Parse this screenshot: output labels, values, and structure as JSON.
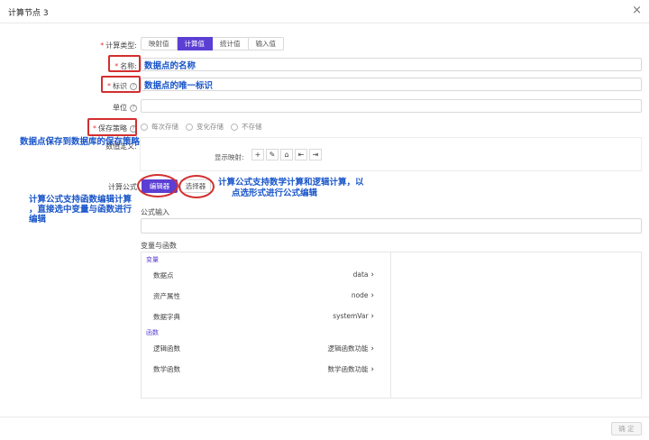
{
  "dialog": {
    "title": "计算节点 3",
    "close_icon": "×",
    "ok_label": "确 定"
  },
  "form": {
    "calc_type": {
      "label": "计算类型:",
      "options": [
        "映射值",
        "计算值",
        "统计值",
        "输入值"
      ],
      "selected": "计算值"
    },
    "name_label": "名称:",
    "id_label": "标识",
    "unit_label": "单位",
    "save_strategy": {
      "label": "保存策略",
      "options": [
        "每次存储",
        "变化存储",
        "不存储"
      ]
    },
    "value_def_label": "数值定义:",
    "display_map_label": "显示映射:",
    "display_tools": [
      "+",
      "✎",
      "⌂",
      "⇤",
      "⇥"
    ],
    "formula_label": "计算公式",
    "formula_buttons": {
      "editor": "编辑器",
      "selector": "选择器"
    },
    "formula_input_label": "公式输入",
    "vars_funcs_label": "变量与函数"
  },
  "vars_funcs": {
    "variables_group": "变量",
    "variables": [
      {
        "name": "数据点",
        "value": "data"
      },
      {
        "name": "资产属性",
        "value": "node"
      },
      {
        "name": "数据字典",
        "value": "systemVar"
      }
    ],
    "functions_group": "函数",
    "functions": [
      {
        "name": "逻辑函数",
        "value": "逻辑函数功能"
      },
      {
        "name": "数学函数",
        "value": "数学函数功能"
      }
    ]
  },
  "annotations": {
    "name_note": "数据点的名称",
    "id_note": "数据点的唯一标识",
    "save_note": "数据点保存到数据库的保存策略",
    "selector_note_line1": "计算公式支持数学计算和逻辑计算，以",
    "selector_note_line2": "点选形式进行公式编辑",
    "editor_note_line1": "计算公式支持函数编辑计算",
    "editor_note_line2": "，直接选中变量与函数进行",
    "editor_note_line3": "编辑"
  },
  "colors": {
    "accent": "#5b3fd4",
    "required": "#e53935",
    "annotation_text": "#1a56c9",
    "annotation_box": "#d32f2f"
  }
}
